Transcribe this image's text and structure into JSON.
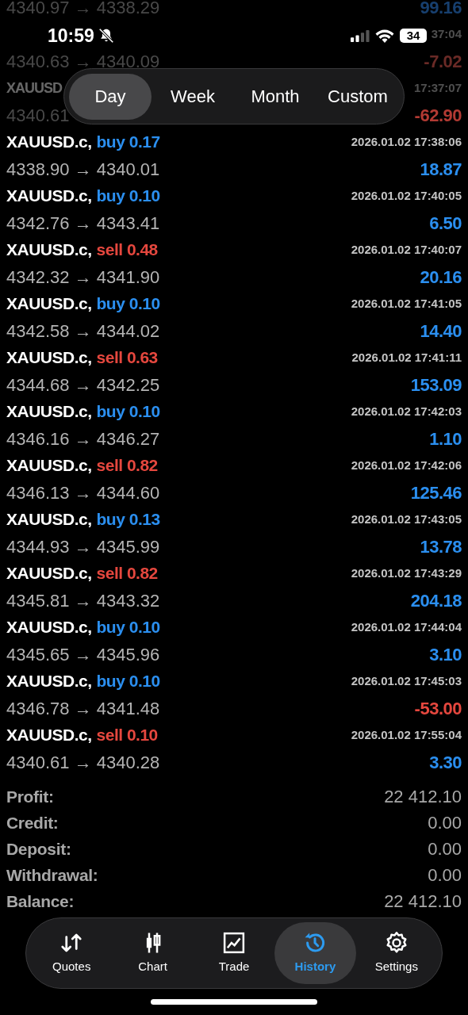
{
  "status_bar": {
    "time": "10:59",
    "battery": "34"
  },
  "period_tabs": [
    {
      "label": "Day",
      "selected": true
    },
    {
      "label": "Week",
      "selected": false
    },
    {
      "label": "Month",
      "selected": false
    },
    {
      "label": "Custom",
      "selected": false
    }
  ],
  "trades": [
    {
      "faded": true,
      "prices": "4340.97 → 4338.29",
      "profit": {
        "text": "99.16",
        "color": "#173f6e"
      }
    },
    {
      "faded": true,
      "time": "37:04",
      "prices": "4340.63 → 4340.09",
      "profit": {
        "text": "-7.02",
        "color": "#6a2a26"
      }
    },
    {
      "faded": true,
      "symbol": "XAUUSD",
      "time": "17:37:07",
      "prices": "4340.61",
      "profit": {
        "text": "-62.90",
        "color": "#b23a33"
      }
    },
    {
      "faded": false,
      "symbol": "XAUUSD.c,",
      "order": {
        "text": "buy 0.17",
        "color": "#2b8ff0"
      },
      "time": "2026.01.02 17:38:06",
      "prices": "4338.90 → 4340.01",
      "profit": {
        "text": "18.87",
        "color": "#2b8ff0"
      }
    },
    {
      "faded": false,
      "symbol": "XAUUSD.c,",
      "order": {
        "text": "buy 0.10",
        "color": "#2b8ff0"
      },
      "time": "2026.01.02 17:40:05",
      "prices": "4342.76 → 4343.41",
      "profit": {
        "text": "6.50",
        "color": "#2b8ff0"
      }
    },
    {
      "faded": false,
      "symbol": "XAUUSD.c,",
      "order": {
        "text": "sell 0.48",
        "color": "#e5473e"
      },
      "time": "2026.01.02 17:40:07",
      "prices": "4342.32 → 4341.90",
      "profit": {
        "text": "20.16",
        "color": "#2b8ff0"
      }
    },
    {
      "faded": false,
      "symbol": "XAUUSD.c,",
      "order": {
        "text": "buy 0.10",
        "color": "#2b8ff0"
      },
      "time": "2026.01.02 17:41:05",
      "prices": "4342.58 → 4344.02",
      "profit": {
        "text": "14.40",
        "color": "#2b8ff0"
      }
    },
    {
      "faded": false,
      "symbol": "XAUUSD.c,",
      "order": {
        "text": "sell 0.63",
        "color": "#e5473e"
      },
      "time": "2026.01.02 17:41:11",
      "prices": "4344.68 → 4342.25",
      "profit": {
        "text": "153.09",
        "color": "#2b8ff0"
      }
    },
    {
      "faded": false,
      "symbol": "XAUUSD.c,",
      "order": {
        "text": "buy 0.10",
        "color": "#2b8ff0"
      },
      "time": "2026.01.02 17:42:03",
      "prices": "4346.16 → 4346.27",
      "profit": {
        "text": "1.10",
        "color": "#2b8ff0"
      }
    },
    {
      "faded": false,
      "symbol": "XAUUSD.c,",
      "order": {
        "text": "sell 0.82",
        "color": "#e5473e"
      },
      "time": "2026.01.02 17:42:06",
      "prices": "4346.13 → 4344.60",
      "profit": {
        "text": "125.46",
        "color": "#2b8ff0"
      }
    },
    {
      "faded": false,
      "symbol": "XAUUSD.c,",
      "order": {
        "text": "buy 0.13",
        "color": "#2b8ff0"
      },
      "time": "2026.01.02 17:43:05",
      "prices": "4344.93 → 4345.99",
      "profit": {
        "text": "13.78",
        "color": "#2b8ff0"
      }
    },
    {
      "faded": false,
      "symbol": "XAUUSD.c,",
      "order": {
        "text": "sell 0.82",
        "color": "#e5473e"
      },
      "time": "2026.01.02 17:43:29",
      "prices": "4345.81 → 4343.32",
      "profit": {
        "text": "204.18",
        "color": "#2b8ff0"
      }
    },
    {
      "faded": false,
      "symbol": "XAUUSD.c,",
      "order": {
        "text": "buy 0.10",
        "color": "#2b8ff0"
      },
      "time": "2026.01.02 17:44:04",
      "prices": "4345.65 → 4345.96",
      "profit": {
        "text": "3.10",
        "color": "#2b8ff0"
      }
    },
    {
      "faded": false,
      "symbol": "XAUUSD.c,",
      "order": {
        "text": "buy 0.10",
        "color": "#2b8ff0"
      },
      "time": "2026.01.02 17:45:03",
      "prices": "4346.78 → 4341.48",
      "profit": {
        "text": "-53.00",
        "color": "#e5473e"
      }
    },
    {
      "faded": false,
      "symbol": "XAUUSD.c,",
      "order": {
        "text": "sell 0.10",
        "color": "#e5473e"
      },
      "time": "2026.01.02 17:55:04",
      "prices": "4340.61 → 4340.28",
      "profit": {
        "text": "3.30",
        "color": "#2b8ff0"
      }
    }
  ],
  "summary": [
    {
      "label": "Profit:",
      "value": "22 412.10"
    },
    {
      "label": "Credit:",
      "value": "0.00"
    },
    {
      "label": "Deposit:",
      "value": "0.00"
    },
    {
      "label": "Withdrawal:",
      "value": "0.00"
    },
    {
      "label": "Balance:",
      "value": "22 412.10"
    }
  ],
  "tab_bar": [
    {
      "kind": "quotes",
      "label": "Quotes",
      "selected": false
    },
    {
      "kind": "chart",
      "label": "Chart",
      "selected": false
    },
    {
      "kind": "trade",
      "label": "Trade",
      "selected": false
    },
    {
      "kind": "history",
      "label": "History",
      "selected": true
    },
    {
      "kind": "settings",
      "label": "Settings",
      "selected": false
    }
  ]
}
